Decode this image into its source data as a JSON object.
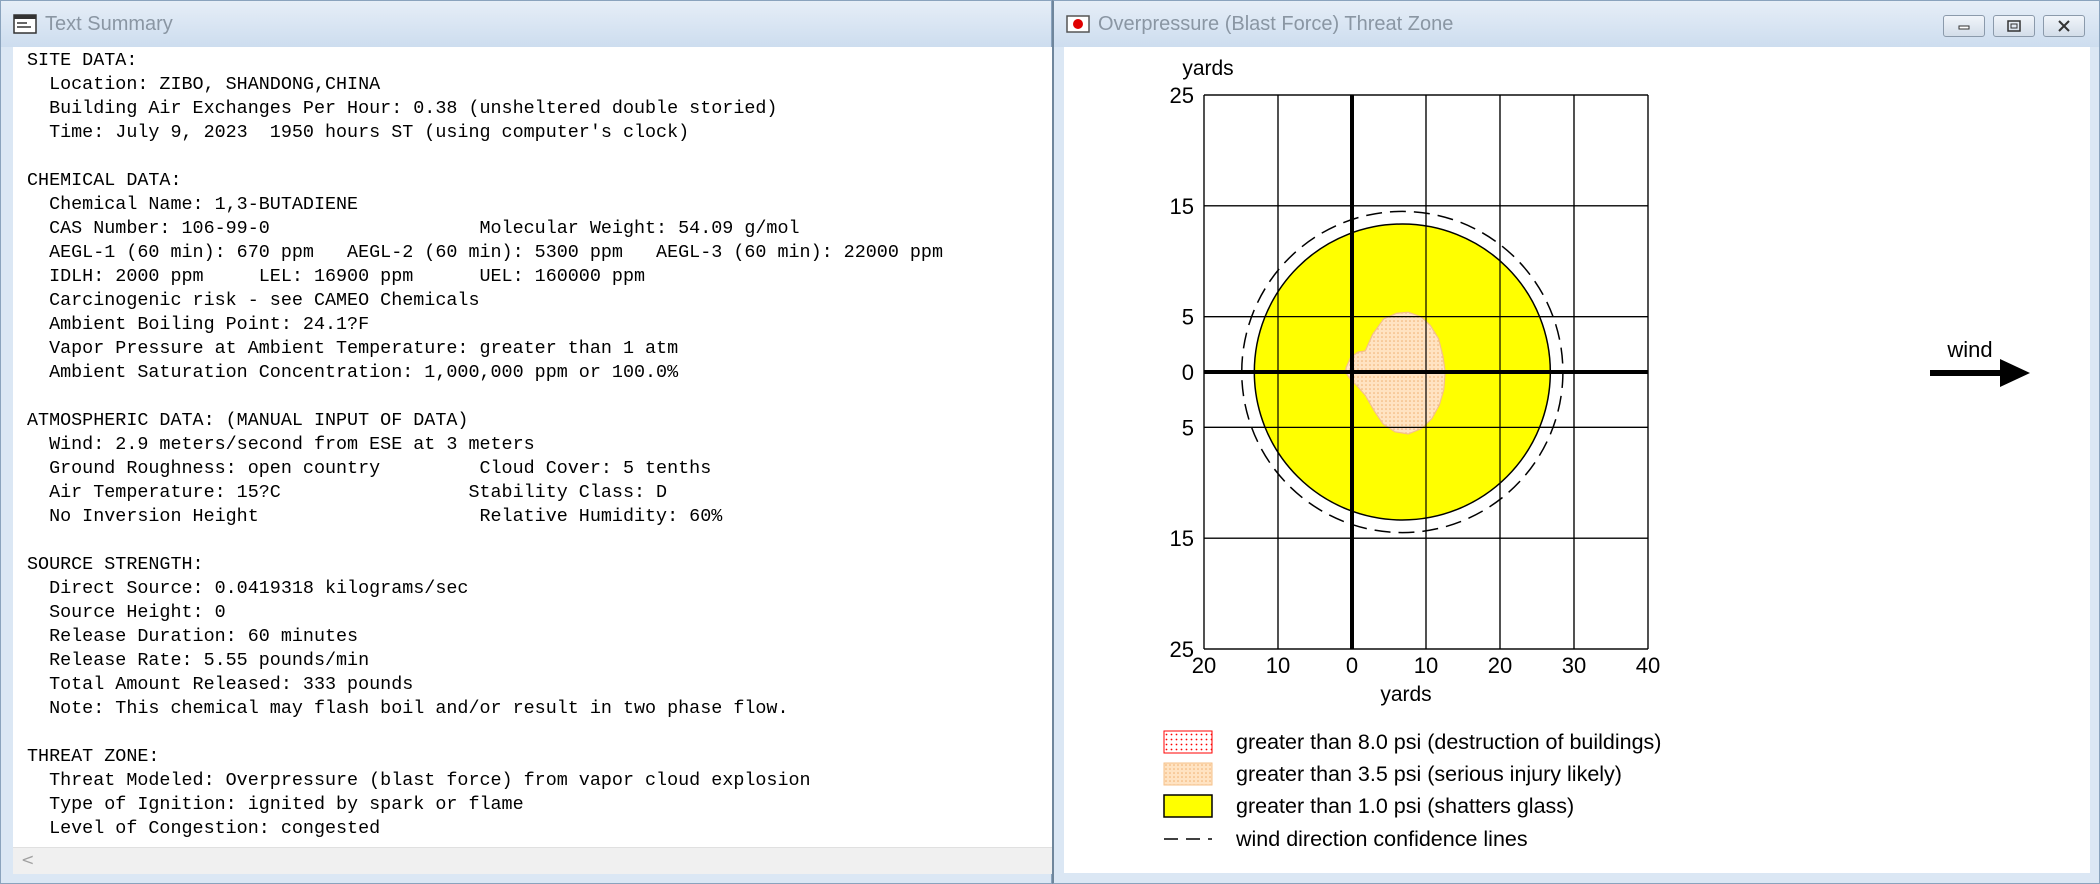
{
  "left_window": {
    "title": "Text Summary",
    "lines": [
      "SITE DATA:",
      "  Location: ZIBO, SHANDONG,CHINA",
      "  Building Air Exchanges Per Hour: 0.38 (unsheltered double storied)",
      "  Time: July 9, 2023  1950 hours ST (using computer's clock)",
      "",
      "CHEMICAL DATA:",
      "  Chemical Name: 1,3-BUTADIENE",
      "  CAS Number: 106-99-0                   Molecular Weight: 54.09 g/mol",
      "  AEGL-1 (60 min): 670 ppm   AEGL-2 (60 min): 5300 ppm   AEGL-3 (60 min): 22000 ppm",
      "  IDLH: 2000 ppm     LEL: 16900 ppm      UEL: 160000 ppm",
      "  Carcinogenic risk - see CAMEO Chemicals",
      "  Ambient Boiling Point: 24.1?F",
      "  Vapor Pressure at Ambient Temperature: greater than 1 atm",
      "  Ambient Saturation Concentration: 1,000,000 ppm or 100.0%",
      "",
      "ATMOSPHERIC DATA: (MANUAL INPUT OF DATA)",
      "  Wind: 2.9 meters/second from ESE at 3 meters",
      "  Ground Roughness: open country         Cloud Cover: 5 tenths",
      "  Air Temperature: 15?C                 Stability Class: D",
      "  No Inversion Height                    Relative Humidity: 60%",
      "",
      "SOURCE STRENGTH:",
      "  Direct Source: 0.0419318 kilograms/sec",
      "  Source Height: 0",
      "  Release Duration: 60 minutes",
      "  Release Rate: 5.55 pounds/min",
      "  Total Amount Released: 333 pounds",
      "  Note: This chemical may flash boil and/or result in two phase flow.",
      "",
      "THREAT ZONE:",
      "  Threat Modeled: Overpressure (blast force) from vapor cloud explosion",
      "  Type of Ignition: ignited by spark or flame",
      "  Level of Congestion: congested"
    ],
    "scroll_left_glyph": "<"
  },
  "right_window": {
    "title": "Overpressure (Blast Force) Threat Zone",
    "controls": {
      "minimize": "minimize",
      "maximize": "maximize",
      "close": "close"
    }
  },
  "chart_data": {
    "type": "area",
    "x_axis": {
      "label": "yards",
      "range": [
        -20,
        40
      ],
      "ticks": [
        -20,
        -10,
        0,
        10,
        20,
        30,
        40
      ],
      "tick_labels": [
        "20",
        "10",
        "0",
        "10",
        "20",
        "30",
        "40"
      ]
    },
    "y_axis": {
      "label": "yards",
      "range": [
        -25,
        25
      ],
      "ticks": [
        25,
        15,
        5,
        0,
        -5,
        -15,
        -25
      ],
      "tick_labels": [
        "25",
        "15",
        "5",
        "0",
        "5",
        "15",
        "25"
      ]
    },
    "grid": true,
    "wind_label": "wind",
    "zones": [
      {
        "name": "greater than 8.0 psi (destruction of buildings)",
        "color": "#ff0000",
        "pattern": "dotted",
        "outline": []
      },
      {
        "name": "greater than 3.5 psi (serious injury likely)",
        "color": "#ffd9b3",
        "outline": [
          [
            -0.8,
            0.4
          ],
          [
            -0.2,
            1.3
          ],
          [
            0.8,
            1.8
          ],
          [
            1.8,
            1.9
          ],
          [
            2.8,
            3.4
          ],
          [
            4.3,
            4.8
          ],
          [
            6.0,
            5.3
          ],
          [
            7.6,
            5.4
          ],
          [
            9.3,
            5.0
          ],
          [
            10.6,
            4.2
          ],
          [
            11.7,
            3.0
          ],
          [
            12.3,
            1.4
          ],
          [
            12.6,
            0.0
          ],
          [
            12.4,
            -1.6
          ],
          [
            11.8,
            -3.0
          ],
          [
            10.8,
            -4.2
          ],
          [
            9.4,
            -5.1
          ],
          [
            7.6,
            -5.6
          ],
          [
            5.8,
            -5.4
          ],
          [
            4.2,
            -4.7
          ],
          [
            3.0,
            -3.5
          ],
          [
            1.8,
            -2.1
          ],
          [
            0.6,
            -1.2
          ],
          [
            -0.3,
            -0.6
          ],
          [
            -0.9,
            0.0
          ]
        ]
      },
      {
        "name": "greater than 1.0 psi (shatters glass)",
        "color": "#ffff00",
        "center": [
          6.8,
          0
        ],
        "radius": 20.0
      }
    ],
    "confidence_lines": {
      "name": "wind direction confidence lines",
      "center": [
        6.8,
        0
      ],
      "radius": 21.7
    }
  }
}
